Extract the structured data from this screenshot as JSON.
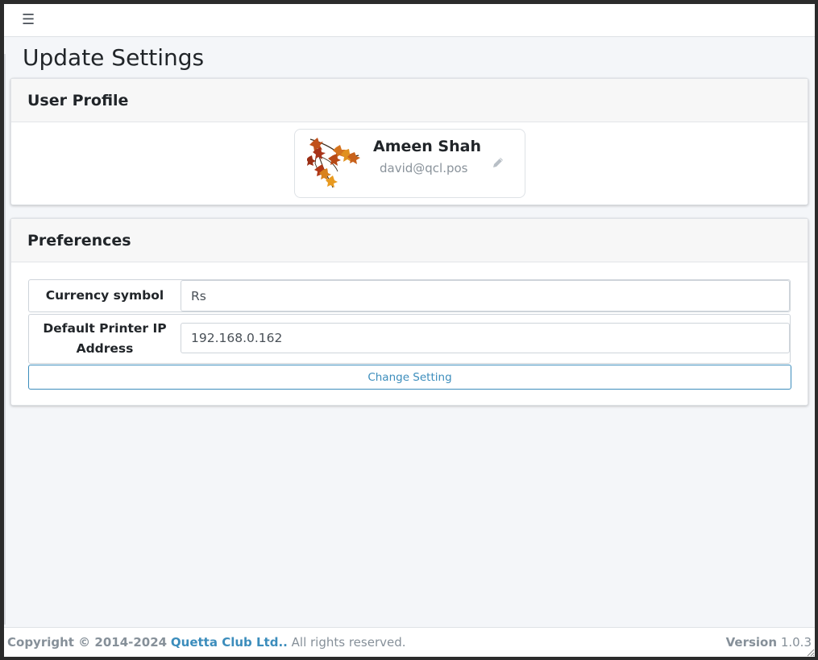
{
  "navbar": {
    "menu_icon": "hamburger-menu-icon",
    "menu_glyph": "☰"
  },
  "page": {
    "title": "Update Settings"
  },
  "user_profile": {
    "card_title": "User Profile",
    "name": "Ameen Shah",
    "email": "david@qcl.pos",
    "avatar_icon": "autumn-leaves-avatar",
    "edit_icon": "pencil-icon"
  },
  "preferences": {
    "card_title": "Preferences",
    "currency_label": "Currency symbol",
    "currency_value": "Rs",
    "printer_label": "Default Printer IP Address",
    "printer_value": "192.168.0.162",
    "submit_label": "Change Setting"
  },
  "footer": {
    "copyright_prefix": "Copyright © 2014-2024",
    "company_link": "Quetta Club Ltd..",
    "rights": "All rights reserved.",
    "version_label": "Version",
    "version_value": "1.0.3"
  },
  "colors": {
    "accent": "#3c8dbc",
    "background": "#f4f6f9",
    "muted_text": "#869099"
  }
}
